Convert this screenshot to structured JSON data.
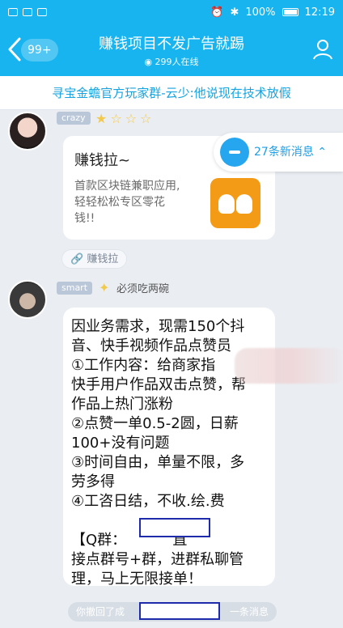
{
  "statusbar": {
    "battery": "100%",
    "time": "12:19"
  },
  "header": {
    "badge": "99+",
    "title": "赚钱项目不发广告就踢",
    "online_count": "299人在线"
  },
  "notice": "寻宝金蟾官方玩家群-云少:他说现在技术放假",
  "messages": [
    {
      "sender": "crazy",
      "card": {
        "title": "赚钱拉~",
        "desc": "首款区块链兼职应用,\n轻轻松松专区零花\n钱!!"
      },
      "link_chip": "赚钱拉"
    },
    {
      "sender": "smart",
      "subtitle": "必须吃两碗",
      "text": "因业务需求，现需150个抖\n音、快手视频作品点赞员\n①工作内容：给商家指\n快手用户作品双击点赞，帮\n作品上热门涨粉\n②点赞一单0.5-2圆，日薪\n100+没有问题\n③时间自由，单量不限，多\n劳多得\n④工咨日结，不收.绘.费\n\n【Q群：          直\n接点群号+群，进群私聊管\n理，马上无限接单！"
    }
  ],
  "floating": {
    "label": "27条新消息"
  },
  "system_note": {
    "left": "你撤回了成",
    "right": "一条消息"
  },
  "colors": {
    "header_bg": "#18b4f0",
    "notice_text": "#17a3df",
    "accent": "#1e9ee6"
  }
}
